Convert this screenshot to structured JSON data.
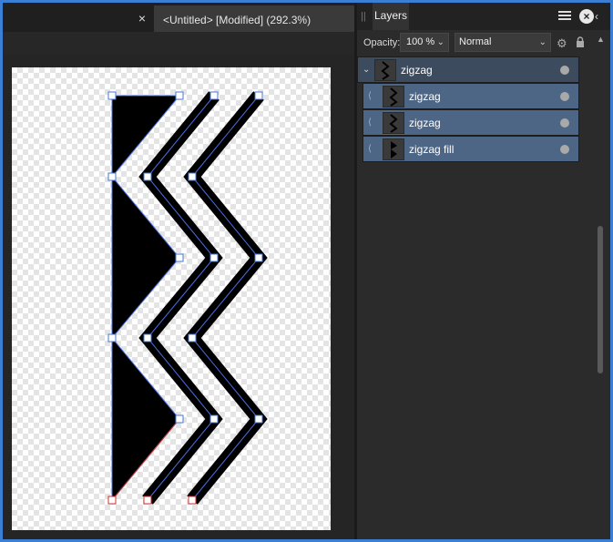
{
  "document": {
    "close_prev_label": "×",
    "tab_title": "<Untitled> [Modified] (292.3%)"
  },
  "layers_panel": {
    "tab_label": "Layers",
    "close_glyph": "×",
    "collapse_glyph": "‹",
    "opacity_label": "Opacity:",
    "opacity_value": "100 %",
    "blend_mode": "Normal",
    "layers": [
      {
        "name": "zigzag",
        "type": "group",
        "expanded": true
      },
      {
        "name": "zigzag",
        "type": "curve"
      },
      {
        "name": "zigzag",
        "type": "curve"
      },
      {
        "name": "zigzag fill",
        "type": "curve"
      }
    ]
  },
  "colors": {
    "selection_accent": "#3a7fd4",
    "layer_selected": "#4d6686",
    "layer_group": "#3d4b5e"
  }
}
